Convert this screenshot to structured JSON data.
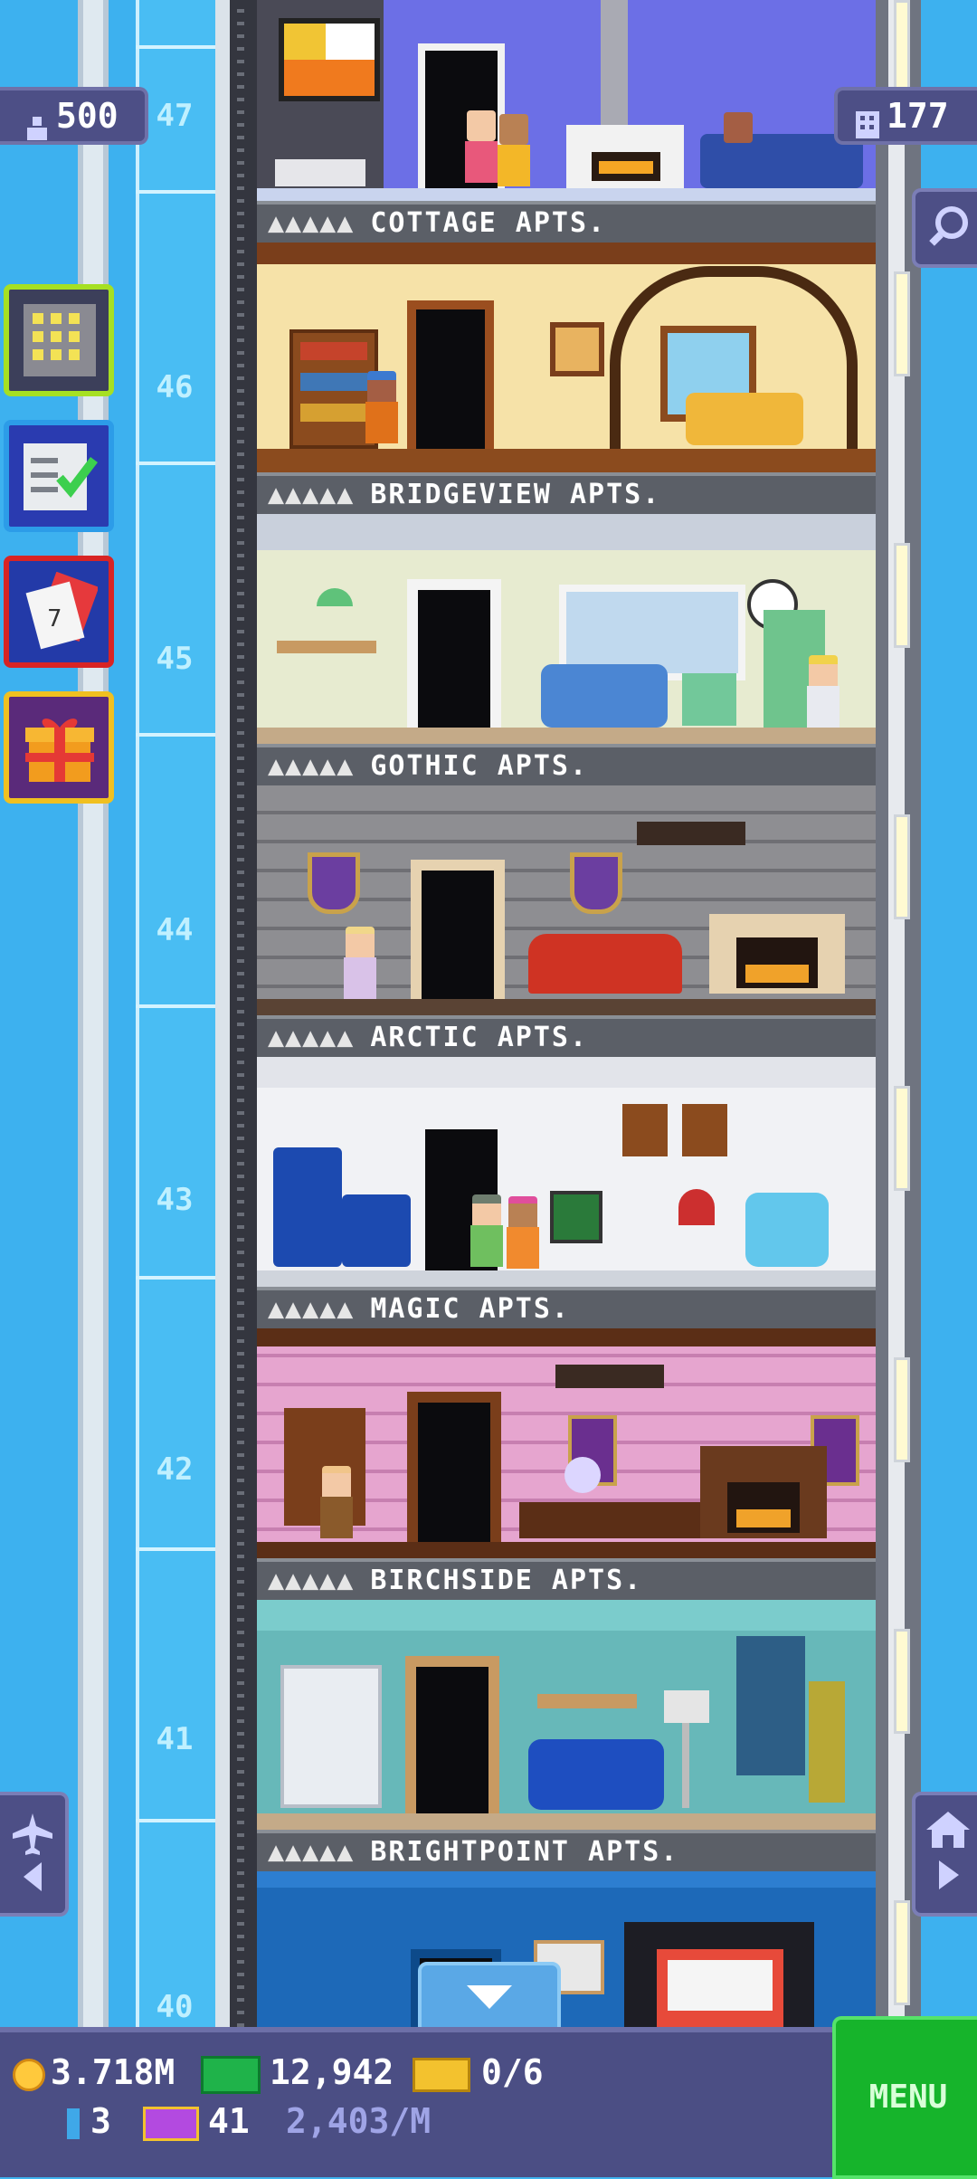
{
  "hud": {
    "population": "500",
    "tower_floors": "177"
  },
  "floor_numbers": [
    "47",
    "46",
    "45",
    "44",
    "43",
    "42",
    "41",
    "40"
  ],
  "floor_labels": [
    "COTTAGE APTS.",
    "BRIDGEVIEW APTS.",
    "GOTHIC APTS.",
    "ARCTIC APTS.",
    "MAGIC APTS.",
    "BIRCHSIDE APTS.",
    "BRIGHTPOINT APTS."
  ],
  "label_dots": "▲▲▲▲▲",
  "bottom_bar": {
    "coins": "3.718M",
    "bux": "12,942",
    "tickets": "0/6",
    "keys": "3",
    "golden": "41",
    "rate": "2,403/M",
    "menu_label": "MENU"
  },
  "icons": {
    "population": "person-icon",
    "floors": "building-icon",
    "zoom": "magnifier-icon",
    "calendar": "calendar-icon",
    "gift": "gift-icon",
    "tasks": "checklist-icon",
    "build": "building-grid-icon"
  },
  "colors": {
    "hud_bg": "#4d4f86",
    "menu_bg": "#16b42b",
    "sky": "#3db1ef"
  }
}
